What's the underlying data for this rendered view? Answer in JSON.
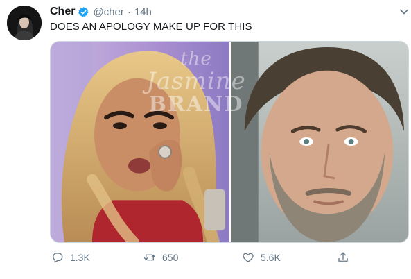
{
  "tweet": {
    "display_name": "Cher",
    "handle": "@cher",
    "separator": "·",
    "time": "14h",
    "text": "DOES AN APOLOGY MAKE UP FOR THIS"
  },
  "media": {
    "watermark": {
      "line1": "the",
      "line2": "Jasmine",
      "line3": "BRAND"
    }
  },
  "actions": {
    "reply_count": "1.3K",
    "retweet_count": "650",
    "like_count": "5.6K"
  },
  "icons": {
    "verified": "verified-badge-icon",
    "caret": "chevron-down-icon",
    "reply": "reply-icon",
    "retweet": "retweet-icon",
    "like": "heart-icon",
    "share": "share-icon"
  },
  "colors": {
    "text": "#14171a",
    "secondary": "#657786",
    "verified": "#1da1f2"
  }
}
